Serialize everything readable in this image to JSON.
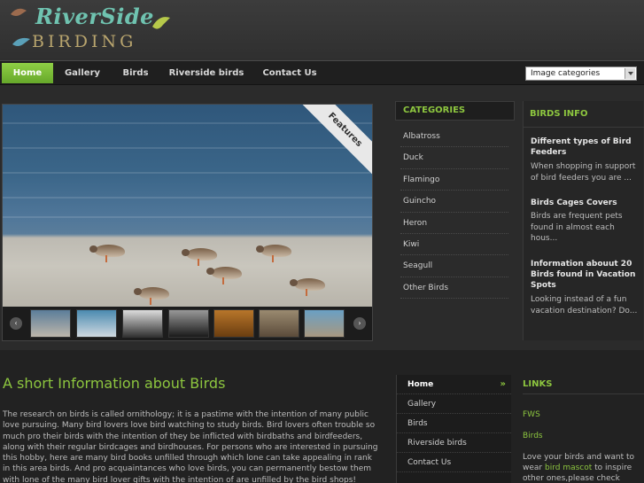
{
  "logo": {
    "line1": "RiverSide",
    "line2": "BIRDING"
  },
  "nav": {
    "items": [
      "Home",
      "Gallery",
      "Birds",
      "Riverside birds",
      "Contact Us"
    ],
    "select_value": "Image categories"
  },
  "slider": {
    "ribbon": "Features",
    "prev": "‹",
    "next": "›"
  },
  "categories": {
    "title": "CATEGORIES",
    "items": [
      "Albatross",
      "Duck",
      "Flamingo",
      "Guincho",
      "Heron",
      "Kiwi",
      "Seagull",
      "Other Birds"
    ]
  },
  "birds_info": {
    "title": "BIRDS INFO",
    "entries": [
      {
        "title": "Different types of Bird Feeders",
        "text": "When shopping in support of bird feeders you are ..."
      },
      {
        "title": "Birds Cages Covers",
        "text": "Birds are frequent pets found in almost each hous..."
      },
      {
        "title": "Information abouut 20 Birds found in Vacation Spots",
        "text": "Looking instead of a fun vacation destination? Do..."
      }
    ]
  },
  "about": {
    "title": "A short Information about Birds",
    "text": "The research on birds is called ornithology; it is a pastime with the intention of many public love pursuing. Many bird lovers love bird watching to study birds. Bird lovers often trouble so much pro their birds with the intention of they be inflicted with birdbaths and birdfeeders, along with their regular birdcages and birdhouses. For persons who are interested in pursuing this hobby, here are many bird books unfilled through which lone can take appealing in rank in this area birds. And pro acquaintances who love birds, you can permanently bestow them with lone of the many bird lover gifts with the intention of are unfilled by the bird shops!"
  },
  "bottom_nav": {
    "items": [
      "Home",
      "Gallery",
      "Birds",
      "Riverside birds",
      "Contact Us"
    ],
    "marker": "»"
  },
  "links": {
    "title": "LINKS",
    "items": [
      "FWS",
      "Birds"
    ],
    "text_before": "Love your birds and want to wear ",
    "text_link": "bird mascot",
    "text_after": " to inspire other ones,please check"
  },
  "colors": {
    "accent": "#8dc63f",
    "background": "#2b2b2b"
  }
}
